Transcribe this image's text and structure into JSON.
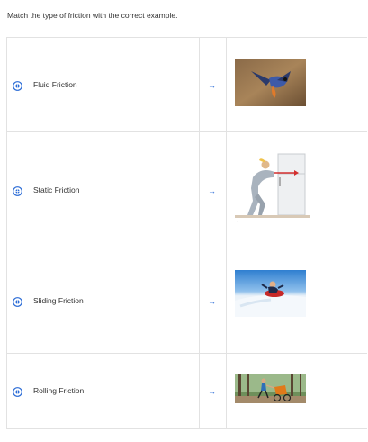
{
  "instruction": "Match the type of friction with the correct example.",
  "arrow_glyph": "→",
  "rows": [
    {
      "label": "Fluid Friction",
      "image": "bird-flying-image"
    },
    {
      "label": "Static Friction",
      "image": "person-pushing-refrigerator-image"
    },
    {
      "label": "Sliding Friction",
      "image": "person-sledding-snow-image"
    },
    {
      "label": "Rolling Friction",
      "image": "person-jogging-stroller-image"
    }
  ],
  "colors": {
    "accent": "#2a6bd6",
    "border": "#e2e2e2",
    "force_arrow": "#d32f2f"
  }
}
